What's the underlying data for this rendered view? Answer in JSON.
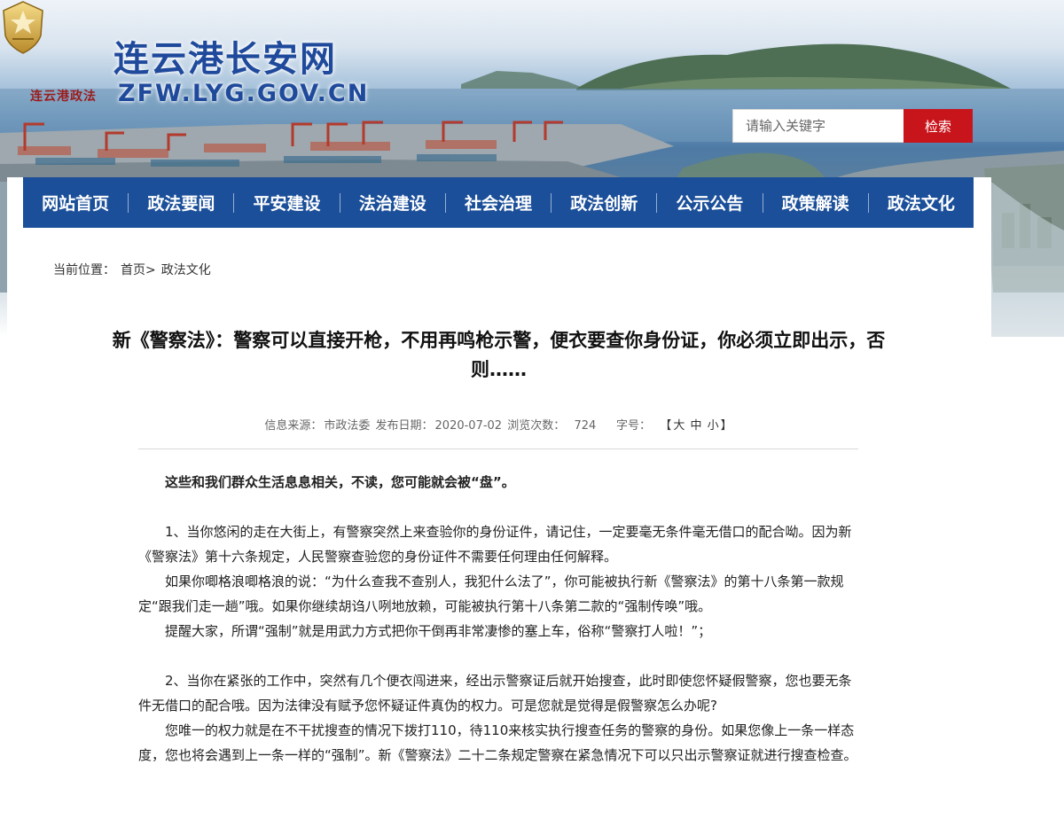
{
  "header": {
    "logo_caption": "连云港政法",
    "site_title": "连云港长安网",
    "site_domain": "ZFW.LYG.GOV.CN"
  },
  "search": {
    "placeholder": "请输入关键字",
    "button_label": "检索"
  },
  "nav": {
    "items": [
      {
        "label": "网站首页"
      },
      {
        "label": "政法要闻"
      },
      {
        "label": "平安建设"
      },
      {
        "label": "法治建设"
      },
      {
        "label": "社会治理"
      },
      {
        "label": "政法创新"
      },
      {
        "label": "公示公告"
      },
      {
        "label": "政策解读"
      },
      {
        "label": "政法文化"
      }
    ]
  },
  "breadcrumb": {
    "prefix": "当前位置：",
    "home": "首页>",
    "current": "政法文化"
  },
  "article": {
    "title": "新《警察法》：警察可以直接开枪，不用再鸣枪示警，便衣要查你身份证，你必须立即出示，否则……",
    "meta": {
      "source_label": "信息来源：",
      "source": "市政法委",
      "date_label": "发布日期：",
      "date": "2020-07-02",
      "views_label": "浏览次数：",
      "views": "724",
      "font_label": "字号：",
      "font_open": "【",
      "font_large": "大",
      "font_medium": "中",
      "font_small": "小",
      "font_close": "】"
    },
    "paragraphs": [
      "这些和我们群众生活息息相关，不读，您可能就会被“盘”。",
      "1、当你悠闲的走在大街上，有警察突然上来查验你的身份证件，请记住，一定要毫无条件毫无借口的配合呦。因为新《警察法》第十六条规定，人民警察查验您的身份证件不需要任何理由任何解释。",
      "如果你唧格浪唧格浪的说：“为什么查我不查别人，我犯什么法了”，你可能被执行新《警察法》的第十八条第一款规定“跟我们走一趟”哦。如果你继续胡诌八咧地放赖，可能被执行第十八条第二款的“强制传唤”哦。",
      "提醒大家，所谓“强制”就是用武力方式把你干倒再非常凄惨的塞上车，俗称“警察打人啦！”；",
      "2、当你在紧张的工作中，突然有几个便衣闯进来，经出示警察证后就开始搜查，此时即使您怀疑假警察，您也要无条件无借口的配合哦。因为法律没有赋予您怀疑证件真伪的权力。可是您就是觉得是假警察怎么办呢?",
      "您唯一的权力就是在不干扰搜查的情况下拨打110，待110来核实执行搜查任务的警察的身份。如果您像上一条一样态度，您也将会遇到上一条一样的“强制”。新《警察法》二十二条规定警察在紧急情况下可以只出示警察证就进行搜查检查。"
    ]
  },
  "colors": {
    "nav_bg": "#1b4f99",
    "search_btn": "#c8151c",
    "title_blue": "#1f4a9c",
    "logo_red": "#9c1c1c"
  }
}
